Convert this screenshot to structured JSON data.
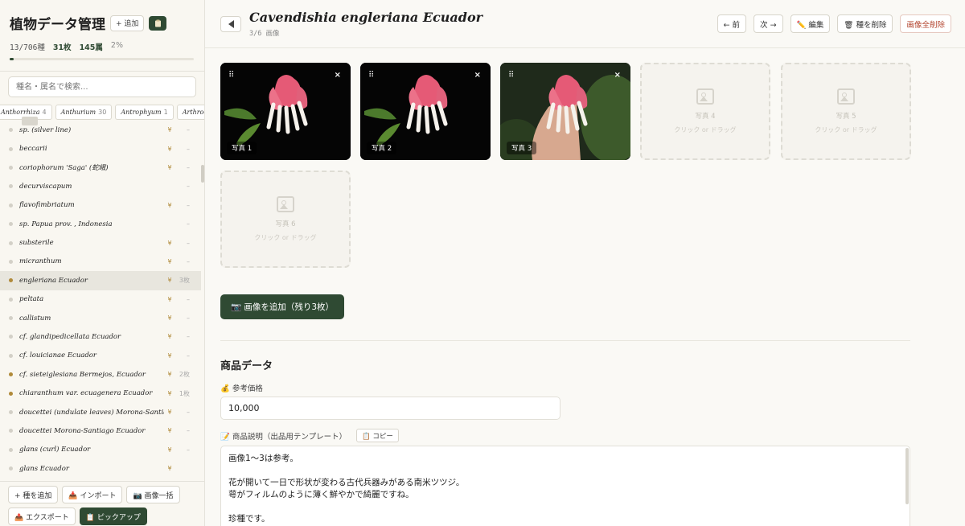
{
  "sidebar": {
    "title": "植物データ管理",
    "add_label": "+ 追加",
    "clipboard_icon": "clipboard-icon",
    "stats": {
      "progress": "13/706種",
      "images": "31枚",
      "genera": "145属",
      "percent": "2%",
      "progress_fraction": 0.02
    },
    "search_placeholder": "種名・属名で検索...",
    "chips": [
      {
        "name": "Anthorrhiza",
        "count": "4"
      },
      {
        "name": "Anthurium",
        "count": "30"
      },
      {
        "name": "Antrophyum",
        "count": "1"
      },
      {
        "name": "Arthrocereus",
        "count": ""
      }
    ],
    "items": [
      {
        "name": "sp. (silver line)",
        "yen": "¥",
        "meta": "–",
        "dot": "plain",
        "active": false
      },
      {
        "name": "beccarii",
        "yen": "¥",
        "meta": "–",
        "dot": "plain",
        "active": false
      },
      {
        "name": "coriophorum 'Saga' (蛇峨)",
        "yen": "¥",
        "meta": "–",
        "dot": "plain",
        "active": false
      },
      {
        "name": "decurviscapum",
        "yen": "",
        "meta": "–",
        "dot": "plain",
        "active": false
      },
      {
        "name": "flavofimbriatum",
        "yen": "¥",
        "meta": "–",
        "dot": "plain",
        "active": false
      },
      {
        "name": "sp. Papua prov. , Indonesia",
        "yen": "",
        "meta": "–",
        "dot": "plain",
        "active": false
      },
      {
        "name": "substerile",
        "yen": "¥",
        "meta": "–",
        "dot": "plain",
        "active": false
      },
      {
        "name": "micranthum",
        "yen": "¥",
        "meta": "–",
        "dot": "plain",
        "active": false
      },
      {
        "name": "engleriana Ecuador",
        "yen": "¥",
        "meta": "3枚",
        "dot": "gold",
        "active": true
      },
      {
        "name": "peltata",
        "yen": "¥",
        "meta": "–",
        "dot": "plain",
        "active": false
      },
      {
        "name": "callistum",
        "yen": "¥",
        "meta": "–",
        "dot": "plain",
        "active": false
      },
      {
        "name": "cf. glandipedicellata Ecuador",
        "yen": "¥",
        "meta": "–",
        "dot": "plain",
        "active": false
      },
      {
        "name": "cf. louicianae Ecuador",
        "yen": "¥",
        "meta": "–",
        "dot": "plain",
        "active": false
      },
      {
        "name": "cf. sieteiglesiana Bermejos, Ecuador",
        "yen": "¥",
        "meta": "2枚",
        "dot": "gold",
        "active": false
      },
      {
        "name": "chiaranthum var. ecuagenera Ecuador",
        "yen": "¥",
        "meta": "1枚",
        "dot": "gold",
        "active": false
      },
      {
        "name": "doucettei (undulate leaves) Morona-Santiago",
        "yen": "¥",
        "meta": "–",
        "dot": "plain",
        "active": false
      },
      {
        "name": "doucettei Morona-Santiago Ecuador",
        "yen": "¥",
        "meta": "–",
        "dot": "plain",
        "active": false
      },
      {
        "name": "glans (curl) Ecuador",
        "yen": "¥",
        "meta": "–",
        "dot": "plain",
        "active": false
      },
      {
        "name": "glans Ecuador",
        "yen": "¥",
        "meta": "",
        "dot": "plain",
        "active": false
      }
    ],
    "footer": {
      "add_species": "+ 種を追加",
      "import": "📥 インポート",
      "bulk_images": "📷 画像一括",
      "export": "📤 エクスポート",
      "pickup": "📋 ピックアップ"
    }
  },
  "header": {
    "title": "Cavendishia engleriana Ecuador",
    "subtitle": "3/6 画像",
    "prev": "← 前",
    "next": "次 →",
    "edit": "✏️ 編集",
    "delete_species": "🗑 種を削除",
    "delete_all_images": "画像全削除"
  },
  "photos": [
    {
      "label": "写真 1",
      "filled": true
    },
    {
      "label": "写真 2",
      "filled": true
    },
    {
      "label": "写真 3",
      "filled": true
    },
    {
      "label": "写真 4",
      "filled": false,
      "hint": "クリック or ドラッグ"
    },
    {
      "label": "写真 5",
      "filled": false,
      "hint": "クリック or ドラッグ"
    },
    {
      "label": "写真 6",
      "filled": false,
      "hint": "クリック or ドラッグ"
    }
  ],
  "photo_controls": {
    "handle": "⠿",
    "close": "×"
  },
  "add_images_button": "📷 画像を追加（残り3枚）",
  "product": {
    "section_title": "商品データ",
    "price_label": "💰 参考価格",
    "price_value": "10,000",
    "desc_label": "📝 商品説明（出品用テンプレート）",
    "copy_label": "📋 コピー",
    "desc_lines": [
      "画像1〜3は参考。",
      "",
      "花が開いて一日で形状が変わる古代兵器みがある南米ツツジ。",
      "萼がフィルムのように薄く鮮やかで綺麗ですね。",
      "",
      "珍種です。"
    ]
  },
  "colors": {
    "accent": "#2f4a33",
    "gold": "#b08a3a",
    "danger": "#b3452f",
    "background": "#faf9f5"
  }
}
